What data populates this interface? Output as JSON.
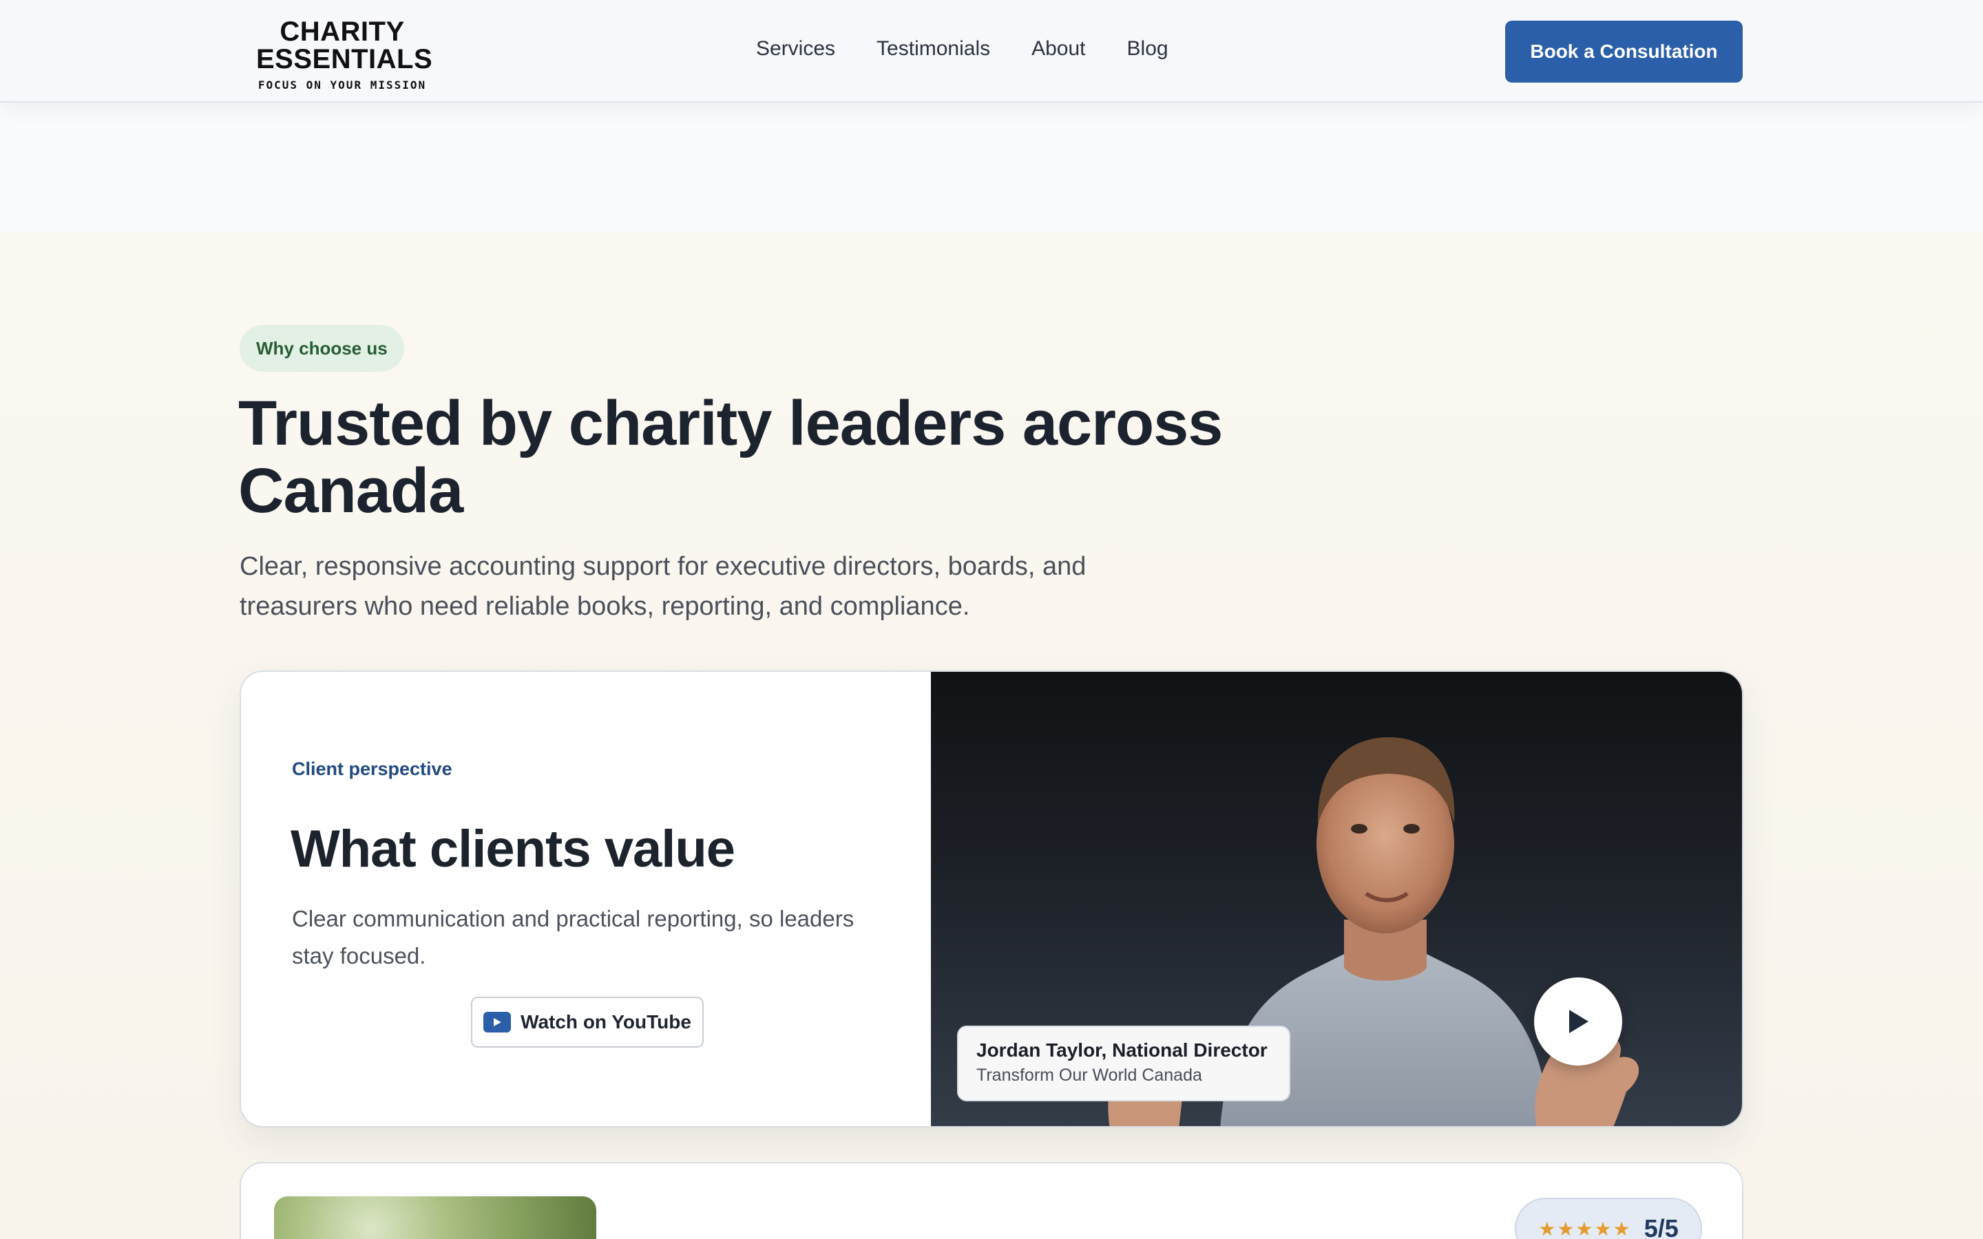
{
  "header": {
    "logo_line1": "CHARITY",
    "logo_line2": "ESSENTIALS",
    "logo_tagline": "FOCUS ON YOUR MISSION",
    "nav": [
      "Services",
      "Testimonials",
      "About",
      "Blog"
    ],
    "cta_label": "Book a Consultation"
  },
  "section": {
    "pill_label": "Why choose us",
    "headline": "Trusted by charity leaders across Canada",
    "subhead": "Clear, responsive accounting support for executive directors, boards, and treasurers who need reliable books, reporting, and compliance."
  },
  "video_card": {
    "eyebrow": "Client perspective",
    "title": "What clients value",
    "text": "Clear communication and practical reporting, so leaders stay focused.",
    "youtube_label": "Watch on YouTube",
    "person_name": "Jordan Taylor, National Director",
    "person_org": "Transform Our World Canada"
  },
  "rating_card": {
    "stars": "★★★★★",
    "score": "5/5",
    "rating_fraction": 1.0
  },
  "colors": {
    "accent": "#2b5fa9",
    "pill_bg": "#e3f0e5",
    "pill_text": "#275d35",
    "star": "#e59b2d"
  },
  "icons": [
    "youtube-icon",
    "play-icon",
    "star-icon"
  ]
}
